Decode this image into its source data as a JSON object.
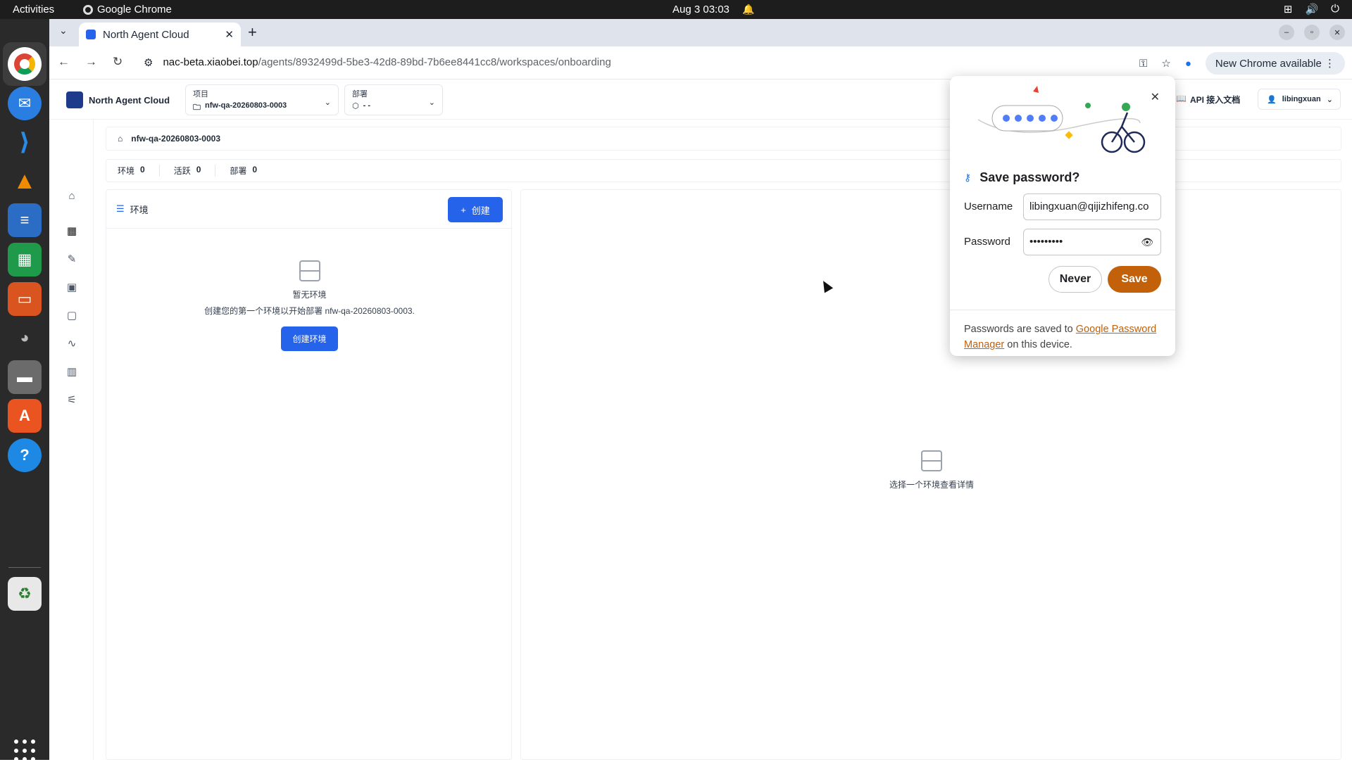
{
  "os": {
    "activities": "Activities",
    "app_name": "Google Chrome",
    "clock": "Aug 3  03:03"
  },
  "browser": {
    "tab_title": "North Agent Cloud",
    "url_host": "nac-beta.xiaobei.top",
    "url_path": "/agents/8932499d-5be3-42d8-89bd-7b6ee8441cc8/workspaces/onboarding",
    "new_chrome": "New Chrome available"
  },
  "header": {
    "logo": "North Agent Cloud",
    "project_label": "项目",
    "project_value": "nfw-qa-20260803-0003",
    "deploy_label": "部署",
    "deploy_value": "- -",
    "api_doc": "API 接入文档",
    "user": "libingxuan"
  },
  "workspace": {
    "name": "nfw-qa-20260803-0003"
  },
  "stats": [
    {
      "label": "环境",
      "value": "0"
    },
    {
      "label": "活跃",
      "value": "0"
    },
    {
      "label": "部署",
      "value": "0"
    }
  ],
  "env_panel": {
    "title": "环境",
    "create": "创建",
    "empty_title": "暂无环境",
    "empty_desc": "创建您的第一个环境以开始部署 nfw-qa-20260803-0003.",
    "create_env": "创建环境"
  },
  "detail": {
    "placeholder": "选择一个环境查看详情"
  },
  "password_dialog": {
    "title": "Save password?",
    "username_label": "Username",
    "username_value": "libingxuan@qijizhifeng.co",
    "password_label": "Password",
    "password_value": "•••••••••",
    "never": "Never",
    "save": "Save",
    "footer_pre": "Passwords are saved to ",
    "footer_link": "Google Password Manager",
    "footer_post": " on this device."
  },
  "colors": {
    "primary": "#2563eb",
    "save_button": "#c2610a",
    "os_bar": "#1d1d1d"
  }
}
